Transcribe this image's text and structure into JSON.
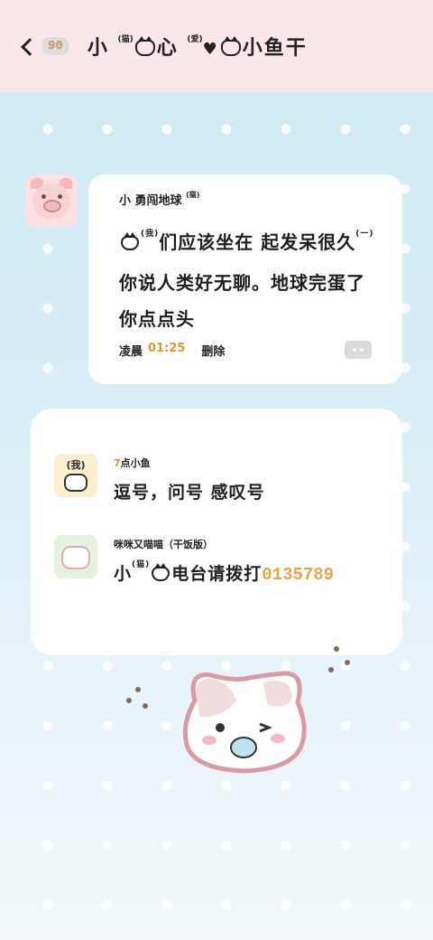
{
  "header": {
    "back_count": "90",
    "title_a": "小",
    "title_ann1": "(猫)",
    "title_b": "心",
    "title_ann2": "(爱)",
    "title_c": "小鱼干"
  },
  "post": {
    "author": "小 勇闯地球",
    "author_ann": "(猫)",
    "message_line1": "们应该坐在 起发呆很久",
    "message_ann1": "(我)",
    "message_ann2": "(一)",
    "message_line2": "你说人类好无聊。地球完蛋了",
    "message_line3": "你点点头",
    "time_label": "凌晨",
    "time_value": "01:25",
    "delete_label": "删除"
  },
  "comments": [
    {
      "name_num": "7",
      "name": "点小鱼",
      "avatar_label": "(我)",
      "message": "逗号，问号 感叹号"
    },
    {
      "name": "咪咪又喵喵（干饭版）",
      "message_a": "小",
      "message_ann": "(猫)",
      "message_b": "电台请拨打",
      "phone": "0135789"
    }
  ],
  "colors": {
    "header_bg": "#fbe6ea",
    "accent": "#d89a3a",
    "phone": "#e8a54a"
  }
}
